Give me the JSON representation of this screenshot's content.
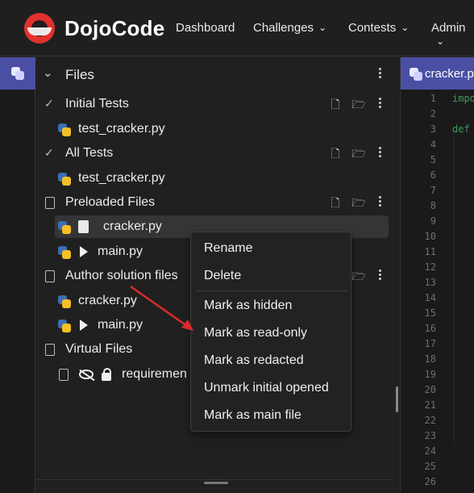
{
  "app": {
    "brand": "DojoCode"
  },
  "nav": {
    "items": [
      {
        "label": "Dashboard",
        "has_menu": false
      },
      {
        "label": "Challenges",
        "has_menu": true
      },
      {
        "label": "Contests",
        "has_menu": true
      },
      {
        "label": "Admin",
        "has_menu": true
      }
    ]
  },
  "sidebar": {
    "header": "Files",
    "sections": [
      {
        "label": "Initial Tests",
        "files": [
          "test_cracker.py"
        ]
      },
      {
        "label": "All Tests",
        "files": [
          "test_cracker.py"
        ]
      },
      {
        "label": "Preloaded Files",
        "files": [
          "cracker.py",
          "main.py"
        ]
      },
      {
        "label": "Author solution files",
        "files": [
          "cracker.py",
          "main.py"
        ]
      },
      {
        "label": "Virtual Files",
        "files": [
          "requiremen"
        ]
      }
    ]
  },
  "context_menu": {
    "items": [
      "Rename",
      "Delete",
      "Mark as hidden",
      "Mark as read-only",
      "Mark as redacted",
      "Unmark initial opened",
      "Mark as main file"
    ]
  },
  "editor": {
    "tab_label": "cracker.py",
    "line_numbers": [
      "1",
      "2",
      "3",
      "4",
      "5",
      "6",
      "7",
      "8",
      "9",
      "10",
      "11",
      "12",
      "13",
      "14",
      "15",
      "16",
      "17",
      "18",
      "19",
      "20",
      "21",
      "22",
      "23",
      "24",
      "25",
      "26"
    ],
    "code": {
      "line1": "impo",
      "line3": "def"
    }
  },
  "colors": {
    "accent": "#4a4fa3",
    "python_yellow": "#f5c026",
    "python_blue": "#3b6fb3",
    "annotation_arrow": "#d92b2b",
    "logo_red": "#e0322f"
  }
}
